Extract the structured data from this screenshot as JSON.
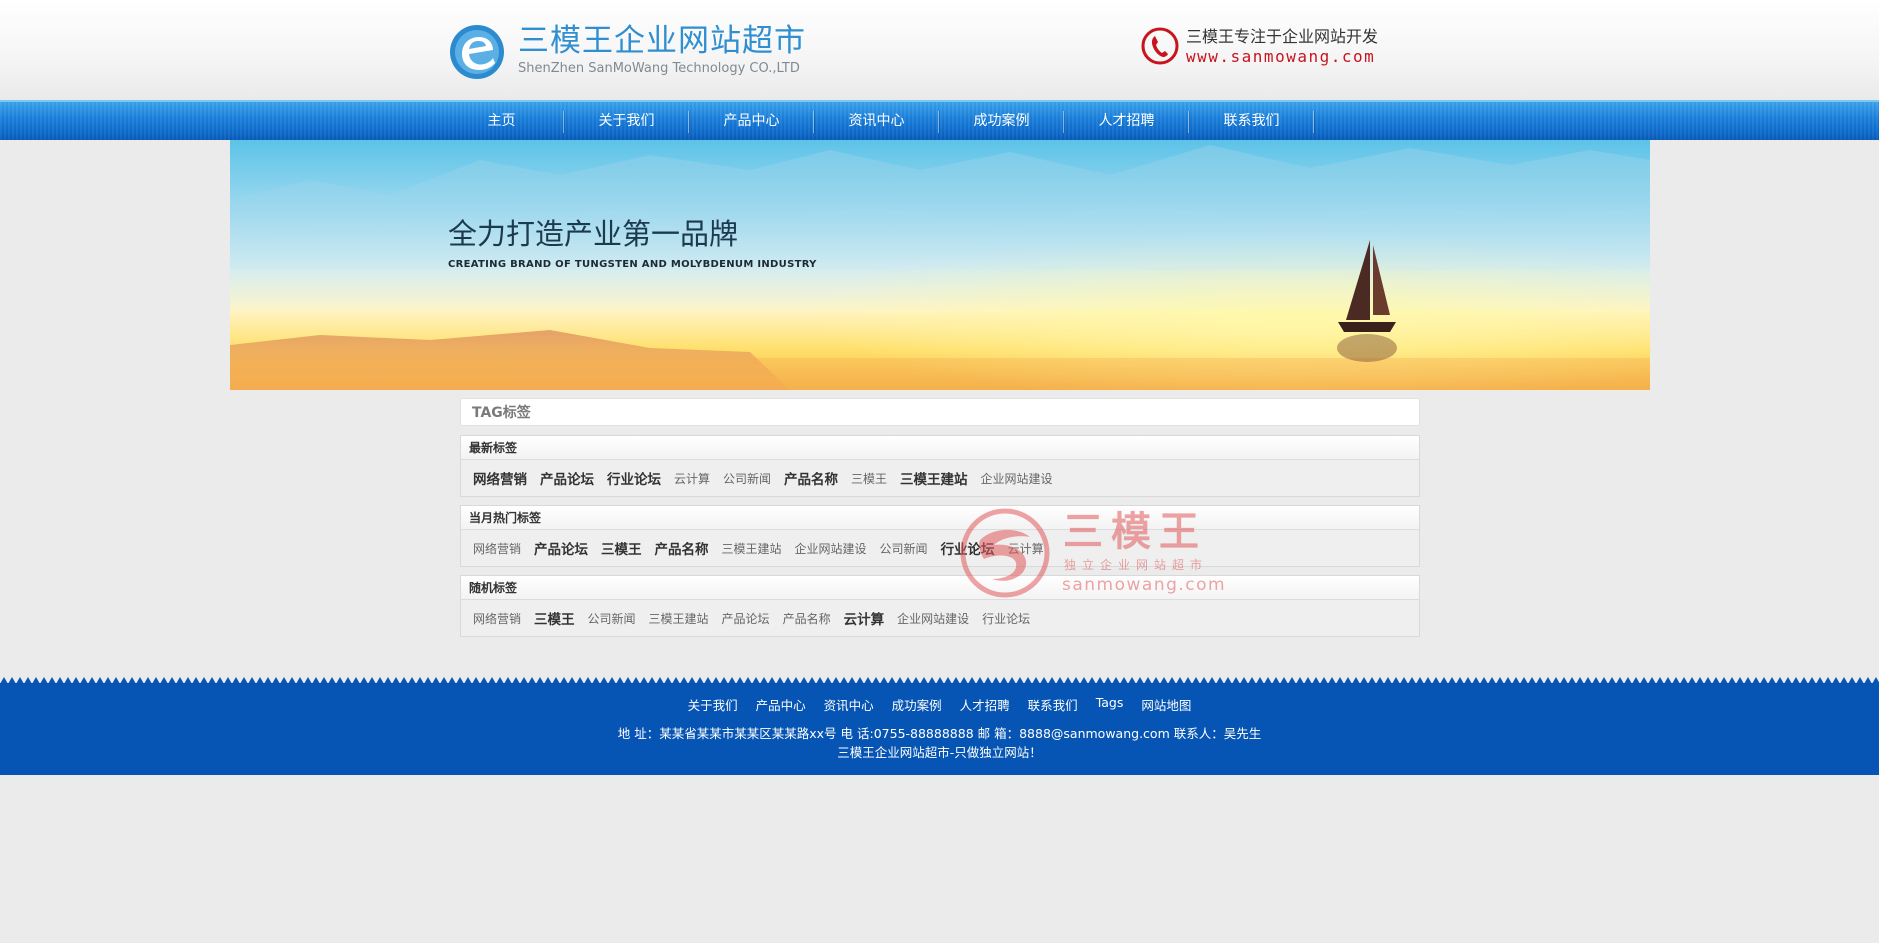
{
  "header": {
    "logo_title": "三模王企业网站超市",
    "logo_subtitle": "ShenZhen SanMoWang Technology CO.,LTD",
    "hotline_text": "三模王专注于企业网站开发",
    "hotline_url": "www.sanmowang.com"
  },
  "nav": {
    "items": [
      "主页",
      "关于我们",
      "产品中心",
      "资讯中心",
      "成功案例",
      "人才招聘",
      "联系我们"
    ]
  },
  "banner": {
    "title": "全力打造产业第一品牌",
    "subtitle": "CREATING BRAND OF TUNGSTEN AND MOLYBDENUM INDUSTRY"
  },
  "tags": {
    "header": "TAG标签",
    "sections": [
      {
        "title": "最新标签",
        "items": [
          {
            "label": "网络营销",
            "bold": true
          },
          {
            "label": "产品论坛",
            "bold": true
          },
          {
            "label": "行业论坛",
            "bold": true
          },
          {
            "label": "云计算",
            "bold": false
          },
          {
            "label": "公司新闻",
            "bold": false
          },
          {
            "label": "产品名称",
            "bold": true
          },
          {
            "label": "三模王",
            "bold": false
          },
          {
            "label": "三模王建站",
            "bold": true
          },
          {
            "label": "企业网站建设",
            "bold": false
          }
        ]
      },
      {
        "title": "当月热门标签",
        "items": [
          {
            "label": "网络营销",
            "bold": false
          },
          {
            "label": "产品论坛",
            "bold": true
          },
          {
            "label": "三模王",
            "bold": true
          },
          {
            "label": "产品名称",
            "bold": true
          },
          {
            "label": "三模王建站",
            "bold": false
          },
          {
            "label": "企业网站建设",
            "bold": false
          },
          {
            "label": "公司新闻",
            "bold": false
          },
          {
            "label": "行业论坛",
            "bold": true
          },
          {
            "label": "云计算",
            "bold": false
          }
        ]
      },
      {
        "title": "随机标签",
        "items": [
          {
            "label": "网络营销",
            "bold": false
          },
          {
            "label": "三模王",
            "bold": true
          },
          {
            "label": "公司新闻",
            "bold": false
          },
          {
            "label": "三模王建站",
            "bold": false
          },
          {
            "label": "产品论坛",
            "bold": false
          },
          {
            "label": "产品名称",
            "bold": false
          },
          {
            "label": "云计算",
            "bold": true
          },
          {
            "label": "企业网站建设",
            "bold": false
          },
          {
            "label": "行业论坛",
            "bold": false
          }
        ]
      }
    ]
  },
  "watermark": {
    "brand": "三模王",
    "slogan": "独立企业网站超市",
    "url": "sanmowang.com"
  },
  "footer": {
    "links": [
      "关于我们",
      "产品中心",
      "资讯中心",
      "成功案例",
      "人才招聘",
      "联系我们",
      "Tags",
      "网站地图"
    ],
    "address": "地 址：某某省某某市某某区某某路xx号 电 话:0755-88888888 邮 箱：8888@sanmowang.com 联系人：吴先生",
    "slogan": "三模王企业网站超市-只做独立网站！"
  },
  "colors": {
    "nav_blue": "#1a7fdc",
    "footer_blue": "#0654b3",
    "logo_blue": "#2f8fd1",
    "hotline_red": "#c8141e",
    "page_bg": "#ebebeb"
  },
  "icons": {
    "logo": "e-logo-icon",
    "hotline": "phone-icon"
  }
}
